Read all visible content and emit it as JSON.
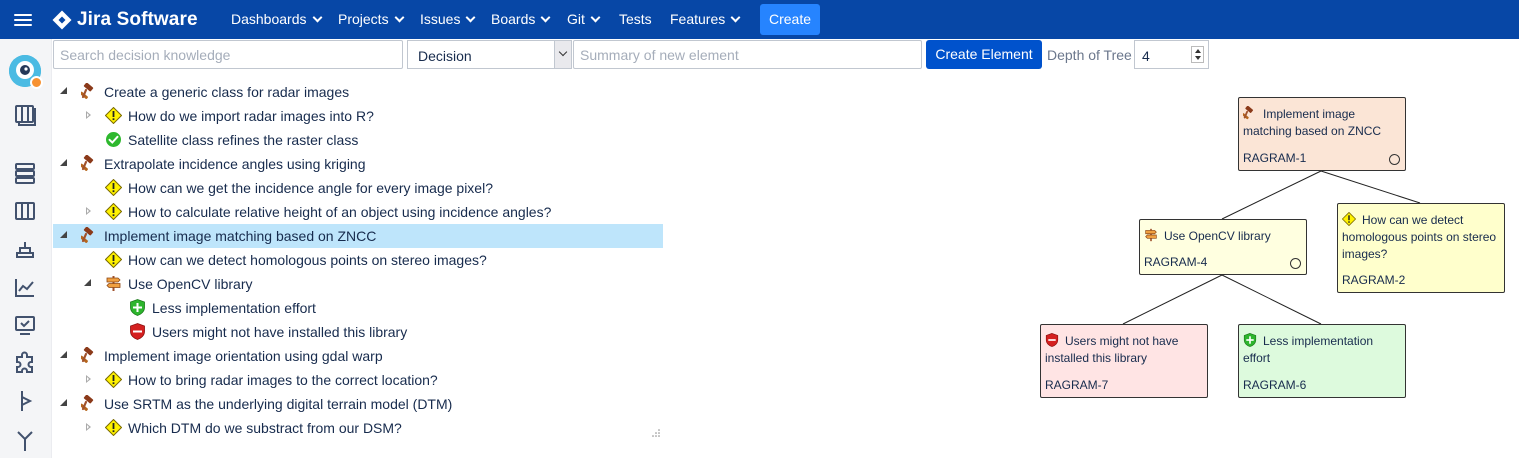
{
  "header": {
    "brand": "Jira Software",
    "nav": [
      {
        "label": "Dashboards",
        "has_dropdown": true
      },
      {
        "label": "Projects",
        "has_dropdown": true
      },
      {
        "label": "Issues",
        "has_dropdown": true
      },
      {
        "label": "Boards",
        "has_dropdown": true
      },
      {
        "label": "Git",
        "has_dropdown": true
      },
      {
        "label": "Tests",
        "has_dropdown": false
      },
      {
        "label": "Features",
        "has_dropdown": true
      }
    ],
    "create_label": "Create"
  },
  "sidebar": {
    "icons": [
      "project-avatar",
      "board-icon",
      "backlog-icon",
      "columns-icon",
      "releases-icon",
      "reports-icon",
      "tests-icon",
      "addons-icon",
      "commit-icon",
      "branch-icon"
    ]
  },
  "toolbar": {
    "search_placeholder": "Search decision knowledge",
    "type_selected": "Decision",
    "summary_placeholder": "Summary of new element",
    "create_element_label": "Create Element",
    "depth_label": "Depth of Tree",
    "depth_value": "4"
  },
  "tree": {
    "rows": [
      {
        "label": "Create a generic class for radar images",
        "type": "decision",
        "toggle": "open",
        "level": 0
      },
      {
        "label": "How do we import radar images into R?",
        "type": "issue",
        "toggle": "closed",
        "level": 1
      },
      {
        "label": "Satellite class refines the raster class",
        "type": "solved",
        "toggle": "none",
        "level": 1
      },
      {
        "label": "Extrapolate incidence angles using kriging",
        "type": "decision",
        "toggle": "open",
        "level": 0
      },
      {
        "label": "How can we get the incidence angle for every image pixel?",
        "type": "issue",
        "toggle": "none",
        "level": 1
      },
      {
        "label": "How to calculate relative height of an object using incidence angles?",
        "type": "issue",
        "toggle": "closed",
        "level": 1
      },
      {
        "label": "Implement image matching based on ZNCC",
        "type": "decision",
        "toggle": "open",
        "level": 0,
        "selected": true
      },
      {
        "label": "How can we detect homologous points on stereo images?",
        "type": "issue",
        "toggle": "none",
        "level": 1
      },
      {
        "label": "Use OpenCV library",
        "type": "alternative",
        "toggle": "open",
        "level": 1
      },
      {
        "label": "Less implementation effort",
        "type": "pro",
        "toggle": "none",
        "level": 2
      },
      {
        "label": "Users might not have installed this library",
        "type": "con",
        "toggle": "none",
        "level": 2
      },
      {
        "label": "Implement image orientation using gdal warp",
        "type": "decision",
        "toggle": "open",
        "level": 0
      },
      {
        "label": "How to bring radar images to the correct location?",
        "type": "issue",
        "toggle": "closed",
        "level": 1
      },
      {
        "label": "Use SRTM as the underlying digital terrain model (DTM)",
        "type": "decision",
        "toggle": "open",
        "level": 0
      },
      {
        "label": "Which DTM do we substract from our DSM?",
        "type": "issue",
        "toggle": "closed",
        "level": 1
      }
    ]
  },
  "graph": {
    "nodes": [
      {
        "id": "n1",
        "text": "Implement image matching based on ZNCC",
        "key": "RAGRAM-1",
        "type": "decision",
        "fill": "#fbe5d6",
        "has_circle": true
      },
      {
        "id": "n4",
        "text": "Use OpenCV library",
        "key": "RAGRAM-4",
        "type": "alternative",
        "fill": "#ffffe0",
        "has_circle": true
      },
      {
        "id": "n2",
        "text": "How can we detect homologous points on stereo images?",
        "key": "RAGRAM-2",
        "type": "issue",
        "fill": "#ffffcc",
        "has_circle": false
      },
      {
        "id": "n7",
        "text": "Users might not have installed this library",
        "key": "RAGRAM-7",
        "type": "con",
        "fill": "#ffe4e4",
        "has_circle": false
      },
      {
        "id": "n6",
        "text": "Less implementation effort",
        "key": "RAGRAM-6",
        "type": "pro",
        "fill": "#ddfadd",
        "has_circle": false
      }
    ]
  },
  "colors": {
    "header": "#0747a6",
    "create_button": "#2684ff",
    "create_element_button": "#0052cc",
    "selected_row": "#bee5fb"
  }
}
